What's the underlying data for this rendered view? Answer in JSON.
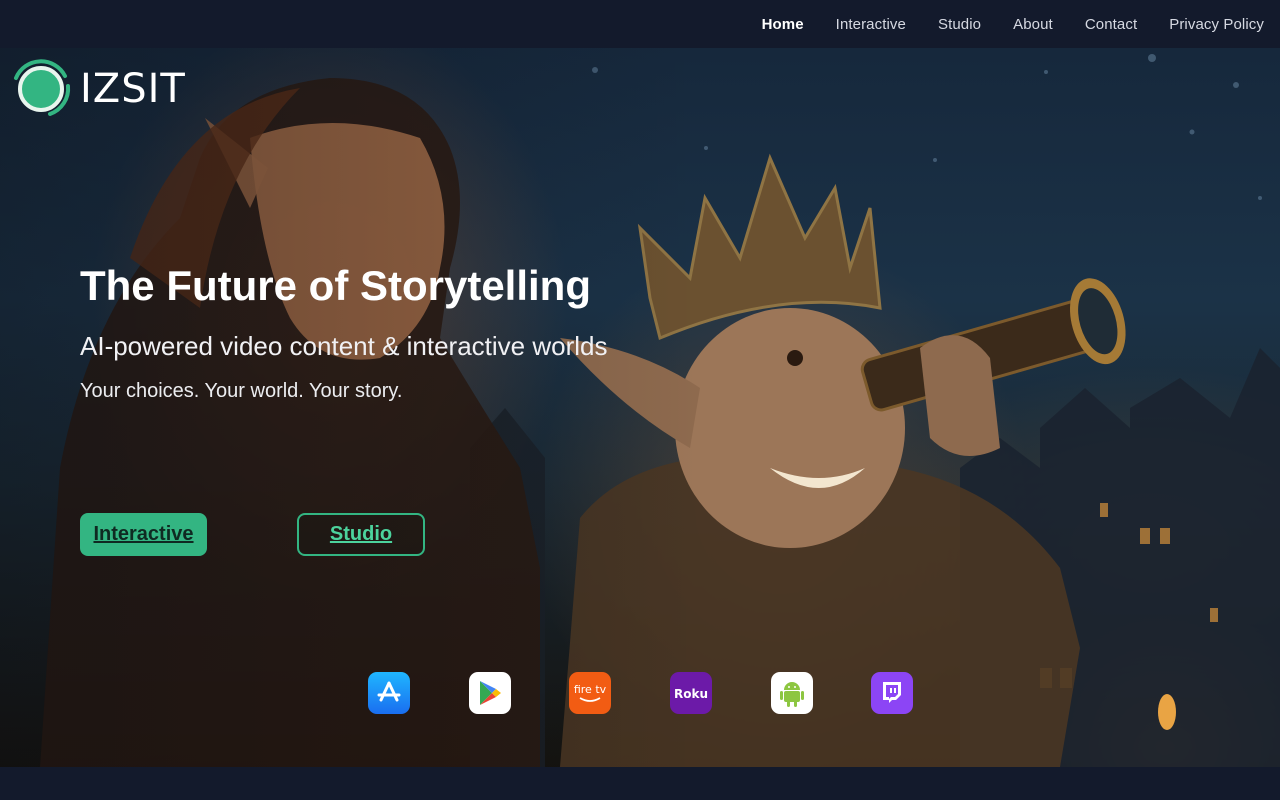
{
  "nav": {
    "items": [
      {
        "label": "Home",
        "active": true
      },
      {
        "label": "Interactive",
        "active": false
      },
      {
        "label": "Studio",
        "active": false
      },
      {
        "label": "About",
        "active": false
      },
      {
        "label": "Contact",
        "active": false
      },
      {
        "label": "Privacy Policy",
        "active": false
      }
    ]
  },
  "logo": {
    "text": "IZSIT",
    "icon": "izsit-ring-logo"
  },
  "hero": {
    "title": "The Future of Storytelling",
    "subtitle": "AI-powered video content & interactive worlds",
    "tagline": "Your choices. Your world. Your story.",
    "primary_button": "Interactive",
    "secondary_button": "Studio"
  },
  "platforms": [
    {
      "name": "app-store-icon",
      "color": "#1a8cf0"
    },
    {
      "name": "google-play-icon",
      "color": "#ffffff"
    },
    {
      "name": "fire-tv-icon",
      "color": "#f25c13",
      "label": "fire tv"
    },
    {
      "name": "roku-icon",
      "color": "#6c1aa8",
      "label": "Roku"
    },
    {
      "name": "android-icon",
      "color": "#ffffff"
    },
    {
      "name": "twitch-icon",
      "color": "#8c45f5"
    }
  ],
  "colors": {
    "accent": "#33b582",
    "header_bg": "#131a2c"
  }
}
